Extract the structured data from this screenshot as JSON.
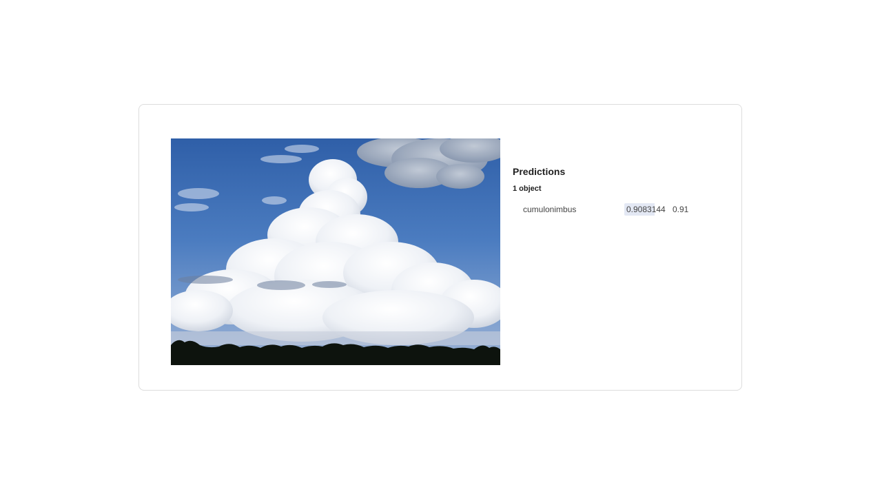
{
  "predictions": {
    "title": "Predictions",
    "count_label": "1 object",
    "items": [
      {
        "label": "cumulonimbus",
        "score": "0.9083144",
        "rounded": "0.91",
        "score_fraction": 0.9083144
      }
    ]
  },
  "image": {
    "subject": "cumulonimbus cloud against blue sky over tree line"
  }
}
